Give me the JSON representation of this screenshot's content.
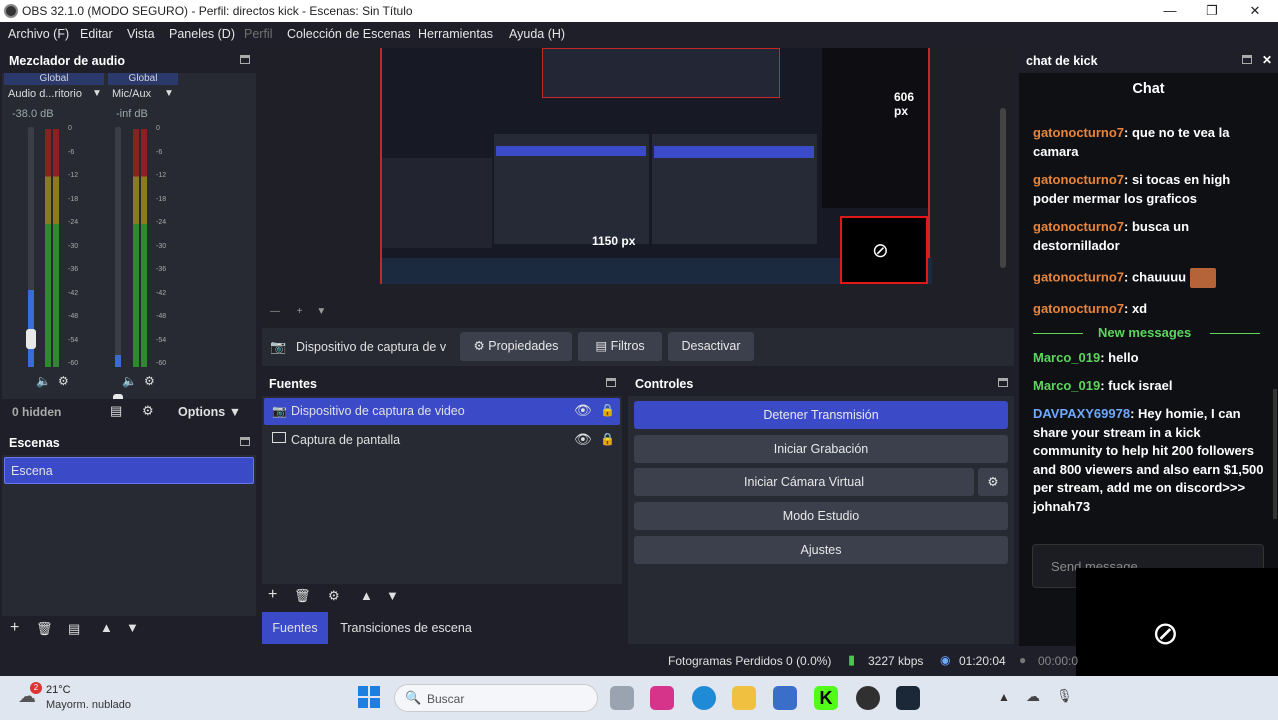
{
  "titlebar": {
    "title": "OBS 32.1.0 (MODO SEGURO) - Perfil: directos kick - Escenas: Sin Título"
  },
  "menu": [
    {
      "label": "Archivo (F)"
    },
    {
      "label": "Editar"
    },
    {
      "label": "Vista"
    },
    {
      "label": "Paneles (D)"
    },
    {
      "label": "Perfil"
    },
    {
      "label": "Colección de Escenas"
    },
    {
      "label": "Herramientas"
    },
    {
      "label": "Ayuda (H)"
    }
  ],
  "mixer": {
    "title": "Mezclador de audio",
    "ch1": {
      "tag": "Global",
      "name": "Audio d...ritorio",
      "db": "-38.0 dB",
      "level": 0.32
    },
    "ch2": {
      "tag": "Global",
      "name": "Mic/Aux",
      "db": "-inf dB",
      "level": 0.05
    },
    "ticks": [
      "0",
      "-6",
      "-12",
      "-18",
      "-24",
      "-30",
      "-36",
      "-42",
      "-48",
      "-54",
      "-60"
    ],
    "hidden": "0 hidden",
    "options": "Options"
  },
  "scenes": {
    "title": "Escenas",
    "items": [
      "Escena"
    ]
  },
  "preview": {
    "label_1150": "1150 px",
    "label_606": "606 px"
  },
  "sourcebar": {
    "name": "Dispositivo de captura de v",
    "props": "Propiedades",
    "filters": "Filtros",
    "deactivate": "Desactivar"
  },
  "sources": {
    "title": "Fuentes",
    "items": [
      "Dispositivo de captura de video",
      "Captura de pantalla"
    ]
  },
  "tabs": {
    "fuentes": "Fuentes",
    "transiciones": "Transiciones de escena"
  },
  "controls": {
    "title": "Controles",
    "stop": "Detener Transmisión",
    "record": "Iniciar Grabación",
    "virtualcam": "Iniciar Cámara Virtual",
    "studio": "Modo Estudio",
    "settings": "Ajustes"
  },
  "chat": {
    "dock": "chat de kick",
    "title": "Chat",
    "messages": [
      {
        "user": "gatonocturno7",
        "text": "que no te vea la camara"
      },
      {
        "user": "gatonocturno7",
        "text": "si tocas en high poder mermar los graficos"
      },
      {
        "user": "gatonocturno7",
        "text": "busca un destornillador"
      },
      {
        "user": "gatonocturno7",
        "text": "chauuuu"
      },
      {
        "user": "gatonocturno7",
        "text": "xd"
      }
    ],
    "divider": "New messages",
    "new": [
      {
        "user": "Marco_019",
        "text": "hello"
      },
      {
        "user": "Marco_019",
        "text": "fuck israel"
      },
      {
        "user": "DAVPAXY69978",
        "text": "Hey homie, I can share your stream in a kick community to help hit 200 followers and 800 viewers and also earn $1,500 per stream, add me on discord>>> johnah73"
      }
    ],
    "placeholder": "Send message..."
  },
  "status": {
    "frames": "Fotogramas Perdidos 0 (0.0%)",
    "kbps": "3227 kbps",
    "time": "01:20:04",
    "rec": "00:00:0"
  },
  "taskbar": {
    "temp": "21°C",
    "weather": "Mayorm. nublado",
    "badge": "2",
    "search": "Buscar"
  },
  "colors": {
    "accent": "#3b4bc8",
    "bg": "#1e1f29",
    "panel": "#272a33",
    "chat_user": "#e8853a",
    "chat_green": "#5cd65c",
    "chat_blue": "#6fa8ff"
  }
}
